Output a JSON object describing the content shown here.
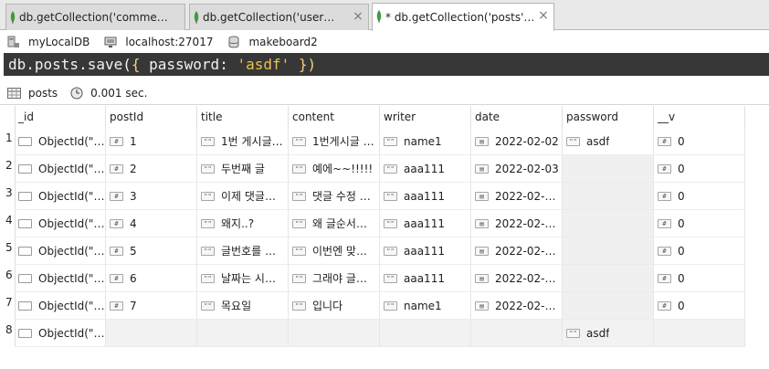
{
  "tabs": [
    {
      "label": "db.getCollection('commen···",
      "active": false
    },
    {
      "label": "db.getCollection('users'),···",
      "active": false
    },
    {
      "label": "* db.getCollection('posts')···",
      "active": true
    }
  ],
  "connection": {
    "connection_name": "myLocalDB",
    "server": "localhost:27017",
    "database": "makeboard2"
  },
  "query": {
    "part1": "db.posts.save(",
    "part2": "{ ",
    "part3": "password",
    "part4": ": ",
    "part5": "'asdf'",
    "part6": " })"
  },
  "results": {
    "collection": "posts",
    "time": "0.001 sec."
  },
  "grid": {
    "columns": [
      "_id",
      "postId",
      "title",
      "content",
      "writer",
      "date",
      "password",
      "__v"
    ],
    "rows": [
      {
        "num": "1",
        "id": "ObjectId(\"6…",
        "postId": "1",
        "title": "1번 게시글…",
        "content": "1번게시글 …",
        "writer": "name1",
        "date": "2022-02-02",
        "password": "asdf",
        "v": "0"
      },
      {
        "num": "2",
        "id": "ObjectId(\"6…",
        "postId": "2",
        "title": "두번째 글",
        "content": "예에~~!!!!!",
        "writer": "aaa111",
        "date": "2022-02-03",
        "password": "",
        "v": "0"
      },
      {
        "num": "3",
        "id": "ObjectId(\"6…",
        "postId": "3",
        "title": "이제 댓글…",
        "content": "댓글 수정 …",
        "writer": "aaa111",
        "date": "2022-02-0…",
        "password": "",
        "v": "0"
      },
      {
        "num": "4",
        "id": "ObjectId(\"6…",
        "postId": "4",
        "title": "왜지..?",
        "content": "왜 글순서…",
        "writer": "aaa111",
        "date": "2022-02-0…",
        "password": "",
        "v": "0"
      },
      {
        "num": "5",
        "id": "ObjectId(\"6…",
        "postId": "5",
        "title": "글번호를 …",
        "content": "이번엔 맞…",
        "writer": "aaa111",
        "date": "2022-02-0…",
        "password": "",
        "v": "0"
      },
      {
        "num": "6",
        "id": "ObjectId(\"6…",
        "postId": "6",
        "title": "날짜는 시…",
        "content": "그래야 글…",
        "writer": "aaa111",
        "date": "2022-02-0…",
        "password": "",
        "v": "0"
      },
      {
        "num": "7",
        "id": "ObjectId(\"6…",
        "postId": "7",
        "title": "목요일",
        "content": "입니다",
        "writer": "name1",
        "date": "2022-02-0…",
        "password": "",
        "v": "0"
      },
      {
        "num": "8",
        "id": "ObjectId(\"6…",
        "postId": "",
        "title": "",
        "content": "",
        "writer": "",
        "date": "",
        "password": "asdf",
        "v": ""
      }
    ]
  },
  "colors": {
    "query_bg": "#373737",
    "leaf_green": "#3f9b3f",
    "empty_cell": "#f0f0f0"
  },
  "icons": {
    "tab": "mongo-leaf-icon",
    "close": "close-icon",
    "connection": "server-connection-icon",
    "server": "monitor-icon",
    "database": "database-icon",
    "collection": "table-grid-icon",
    "time": "clock-icon",
    "object_type": "object-type-icon",
    "int_type": "int32-type-icon",
    "string_type": "string-type-icon",
    "date_type": "date-type-icon"
  }
}
